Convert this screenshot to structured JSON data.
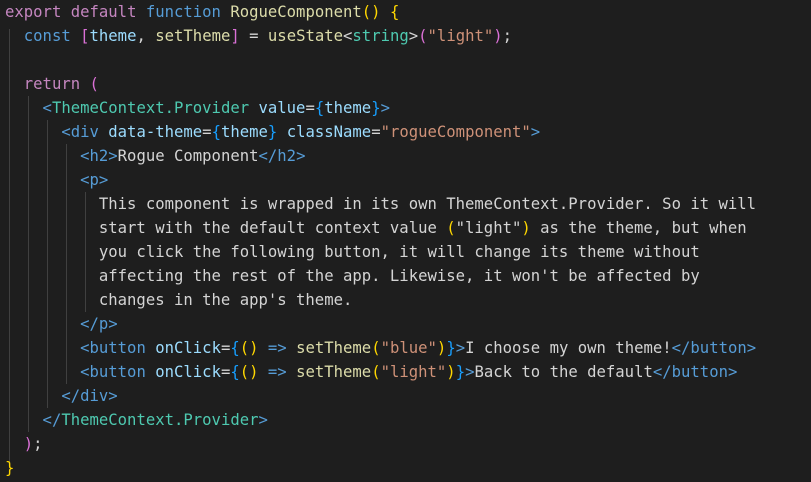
{
  "editor": {
    "language": "tsx",
    "lines": [
      [
        [
          "export",
          "kw"
        ],
        [
          " ",
          "pun"
        ],
        [
          "default",
          "kw"
        ],
        [
          " ",
          "pun"
        ],
        [
          "function",
          "dkw"
        ],
        [
          " ",
          "pun"
        ],
        [
          "RogueComponent",
          "fn"
        ],
        [
          "()",
          "b1"
        ],
        [
          " ",
          "pun"
        ],
        [
          "{",
          "b1"
        ]
      ],
      [
        [
          "  ",
          "pun"
        ],
        [
          "const",
          "dkw"
        ],
        [
          " ",
          "pun"
        ],
        [
          "[",
          "b2"
        ],
        [
          "theme",
          "var"
        ],
        [
          ", ",
          "pun"
        ],
        [
          "setTheme",
          "fn"
        ],
        [
          "]",
          "b2"
        ],
        [
          " = ",
          "pun"
        ],
        [
          "useState",
          "fn"
        ],
        [
          "<",
          "pun"
        ],
        [
          "string",
          "type"
        ],
        [
          ">",
          "pun"
        ],
        [
          "(",
          "b2"
        ],
        [
          "\"light\"",
          "str"
        ],
        [
          ")",
          "b2"
        ],
        [
          ";",
          "pun"
        ]
      ],
      [],
      [
        [
          "  ",
          "pun"
        ],
        [
          "return",
          "kw"
        ],
        [
          " ",
          "pun"
        ],
        [
          "(",
          "b2"
        ]
      ],
      [
        [
          "    <",
          "tag"
        ],
        [
          "ThemeContext.Provider",
          "comp"
        ],
        [
          " ",
          "pun"
        ],
        [
          "value",
          "attr"
        ],
        [
          "=",
          "pun"
        ],
        [
          "{",
          "b3"
        ],
        [
          "theme",
          "var"
        ],
        [
          "}",
          "b3"
        ],
        [
          ">",
          "tag"
        ]
      ],
      [
        [
          "      <",
          "tag"
        ],
        [
          "div",
          "tag"
        ],
        [
          " ",
          "pun"
        ],
        [
          "data-theme",
          "attr"
        ],
        [
          "=",
          "pun"
        ],
        [
          "{",
          "b3"
        ],
        [
          "theme",
          "var"
        ],
        [
          "}",
          "b3"
        ],
        [
          " ",
          "pun"
        ],
        [
          "className",
          "attr"
        ],
        [
          "=",
          "pun"
        ],
        [
          "\"rogueComponent\"",
          "str"
        ],
        [
          ">",
          "tag"
        ]
      ],
      [
        [
          "        <",
          "tag"
        ],
        [
          "h2",
          "tag"
        ],
        [
          ">",
          "tag"
        ],
        [
          "Rogue Component",
          "txt"
        ],
        [
          "</",
          "tag"
        ],
        [
          "h2",
          "tag"
        ],
        [
          ">",
          "tag"
        ]
      ],
      [
        [
          "        <",
          "tag"
        ],
        [
          "p",
          "tag"
        ],
        [
          ">",
          "tag"
        ]
      ],
      [
        [
          "          This component is wrapped in its own ThemeContext.Provider. So it will",
          "txt"
        ]
      ],
      [
        [
          "          start with the default context value ",
          "txt"
        ],
        [
          "(",
          "b1"
        ],
        [
          "\"light\"",
          "txt"
        ],
        [
          ")",
          "b1"
        ],
        [
          " as the theme, but when",
          "txt"
        ]
      ],
      [
        [
          "          you click the following button, it will change its theme without",
          "txt"
        ]
      ],
      [
        [
          "          affecting the rest of the app. Likewise, it won't be affected by",
          "txt"
        ]
      ],
      [
        [
          "          changes in the app's theme.",
          "txt"
        ]
      ],
      [
        [
          "        </",
          "tag"
        ],
        [
          "p",
          "tag"
        ],
        [
          ">",
          "tag"
        ]
      ],
      [
        [
          "        <",
          "tag"
        ],
        [
          "button",
          "tag"
        ],
        [
          " ",
          "pun"
        ],
        [
          "onClick",
          "attr"
        ],
        [
          "=",
          "pun"
        ],
        [
          "{",
          "b3"
        ],
        [
          "()",
          "b1"
        ],
        [
          " ",
          "pun"
        ],
        [
          "=>",
          "dkw"
        ],
        [
          " ",
          "pun"
        ],
        [
          "setTheme",
          "fn"
        ],
        [
          "(",
          "b1"
        ],
        [
          "\"blue\"",
          "str"
        ],
        [
          ")",
          "b1"
        ],
        [
          "}",
          "b3"
        ],
        [
          ">",
          "tag"
        ],
        [
          "I choose my own theme!",
          "txt"
        ],
        [
          "</",
          "tag"
        ],
        [
          "button",
          "tag"
        ],
        [
          ">",
          "tag"
        ]
      ],
      [
        [
          "        <",
          "tag"
        ],
        [
          "button",
          "tag"
        ],
        [
          " ",
          "pun"
        ],
        [
          "onClick",
          "attr"
        ],
        [
          "=",
          "pun"
        ],
        [
          "{",
          "b3"
        ],
        [
          "()",
          "b1"
        ],
        [
          " ",
          "pun"
        ],
        [
          "=>",
          "dkw"
        ],
        [
          " ",
          "pun"
        ],
        [
          "setTheme",
          "fn"
        ],
        [
          "(",
          "b1"
        ],
        [
          "\"light\"",
          "str"
        ],
        [
          ")",
          "b1"
        ],
        [
          "}",
          "b3"
        ],
        [
          ">",
          "tag"
        ],
        [
          "Back to the default",
          "txt"
        ],
        [
          "</",
          "tag"
        ],
        [
          "button",
          "tag"
        ],
        [
          ">",
          "tag"
        ]
      ],
      [
        [
          "      </",
          "tag"
        ],
        [
          "div",
          "tag"
        ],
        [
          ">",
          "tag"
        ]
      ],
      [
        [
          "    </",
          "tag"
        ],
        [
          "ThemeContext.Provider",
          "comp"
        ],
        [
          ">",
          "tag"
        ]
      ],
      [
        [
          "  ",
          "pun"
        ],
        [
          ")",
          "b2"
        ],
        [
          ";",
          "pun"
        ]
      ],
      [
        [
          "}",
          "b1"
        ]
      ]
    ]
  },
  "colors": {
    "background": "#1e1e1e",
    "keyword": "#c586c0",
    "declaration": "#569cd6",
    "function": "#dcdcaa",
    "variable": "#9cdcfe",
    "type": "#4ec9b0",
    "string": "#ce9178",
    "bracket_gold": "#ffd700",
    "bracket_orchid": "#da70d6",
    "bracket_blue": "#179fff"
  }
}
